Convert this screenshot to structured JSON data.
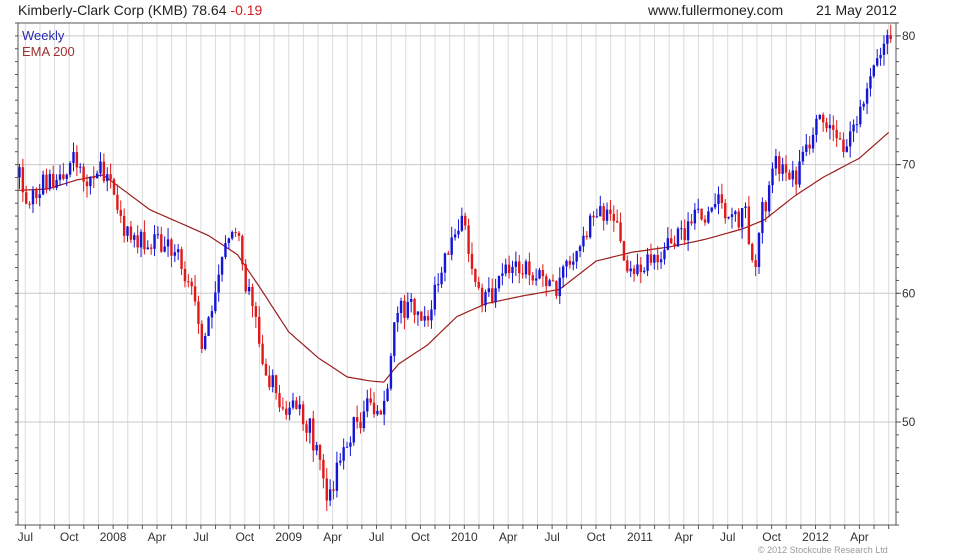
{
  "header": {
    "name": "Kimberly-Clark Corp (KMB)",
    "price": "78.64",
    "change": "-0.19",
    "site": "www.fullermoney.com",
    "date": "21 May 2012"
  },
  "footer": {
    "copyright": "© 2012 Stockcube Research Ltd"
  },
  "colors": {
    "up": "#1515d8",
    "down": "#e01818",
    "ema": "#9a1e1e",
    "grid": "#dcdcdc",
    "axis": "#555555"
  },
  "chart_data": {
    "type": "candlestick",
    "legend": [
      "Weekly",
      "EMA 200"
    ],
    "legend_position": "top-left",
    "ylim": [
      42,
      81
    ],
    "yticks": [
      50,
      60,
      70,
      80
    ],
    "y_axis_side": "right",
    "grid": true,
    "x_range_months": [
      0,
      59.5
    ],
    "xticks": [
      {
        "label": "Jul",
        "month": 0
      },
      {
        "label": "Oct",
        "month": 3
      },
      {
        "label": "2008",
        "month": 6
      },
      {
        "label": "Apr",
        "month": 9
      },
      {
        "label": "Jul",
        "month": 12
      },
      {
        "label": "Oct",
        "month": 15
      },
      {
        "label": "2009",
        "month": 18
      },
      {
        "label": "Apr",
        "month": 21
      },
      {
        "label": "Jul",
        "month": 24
      },
      {
        "label": "Oct",
        "month": 27
      },
      {
        "label": "2010",
        "month": 30
      },
      {
        "label": "Apr",
        "month": 33
      },
      {
        "label": "Jul",
        "month": 36
      },
      {
        "label": "Oct",
        "month": 39
      },
      {
        "label": "2011",
        "month": 42
      },
      {
        "label": "Apr",
        "month": 45
      },
      {
        "label": "Jul",
        "month": 48
      },
      {
        "label": "Oct",
        "month": 51
      },
      {
        "label": "2012",
        "month": 54
      },
      {
        "label": "Apr",
        "month": 57
      }
    ],
    "price_keypoints": [
      [
        -0.5,
        69
      ],
      [
        0.3,
        67.5
      ],
      [
        1.5,
        68.5
      ],
      [
        2.3,
        69
      ],
      [
        3.3,
        70.2
      ],
      [
        4.5,
        69
      ],
      [
        5.3,
        69.7
      ],
      [
        5.8,
        68.5
      ],
      [
        6.6,
        65.5
      ],
      [
        7.5,
        64
      ],
      [
        8.5,
        64.5
      ],
      [
        9.5,
        63.8
      ],
      [
        10.5,
        63.2
      ],
      [
        11.5,
        60
      ],
      [
        12.1,
        55
      ],
      [
        12.5,
        58
      ],
      [
        13,
        61
      ],
      [
        13.5,
        63
      ],
      [
        14.3,
        66
      ],
      [
        14.8,
        62
      ],
      [
        15.5,
        58.5
      ],
      [
        16.1,
        56
      ],
      [
        16.7,
        53
      ],
      [
        17.3,
        52
      ],
      [
        18.3,
        51
      ],
      [
        19.3,
        50
      ],
      [
        20.1,
        46.5
      ],
      [
        20.7,
        44
      ],
      [
        21.3,
        46
      ],
      [
        22.2,
        49
      ],
      [
        23.2,
        51
      ],
      [
        24.3,
        51.5
      ],
      [
        24.8,
        53
      ],
      [
        25.3,
        58
      ],
      [
        26.3,
        59.5
      ],
      [
        27.2,
        58
      ],
      [
        28.2,
        60.5
      ],
      [
        28.8,
        63.5
      ],
      [
        29.5,
        66
      ],
      [
        30.3,
        64
      ],
      [
        30.8,
        61
      ],
      [
        31.3,
        59.5
      ],
      [
        32.3,
        60.5
      ],
      [
        33.3,
        62.5
      ],
      [
        34.3,
        61.5
      ],
      [
        35.3,
        61
      ],
      [
        36.5,
        60.5
      ],
      [
        37.3,
        62.5
      ],
      [
        38.3,
        64.5
      ],
      [
        39.3,
        66.3
      ],
      [
        40.3,
        65.5
      ],
      [
        41.2,
        62.5
      ],
      [
        41.6,
        61.5
      ],
      [
        42.5,
        62
      ],
      [
        43.3,
        63
      ],
      [
        44.3,
        64.5
      ],
      [
        45.3,
        65.3
      ],
      [
        46.3,
        66
      ],
      [
        47.3,
        67.5
      ],
      [
        48.2,
        66
      ],
      [
        49.2,
        66.2
      ],
      [
        49.5,
        63
      ],
      [
        49.8,
        62
      ],
      [
        50.3,
        66
      ],
      [
        51.3,
        70.5
      ],
      [
        52.3,
        69.5
      ],
      [
        52.8,
        68.8
      ],
      [
        53.3,
        71.5
      ],
      [
        54.5,
        73.5
      ],
      [
        55.3,
        71.5
      ],
      [
        56.3,
        72
      ],
      [
        57.3,
        74
      ],
      [
        58,
        77.5
      ],
      [
        58.8,
        79.5
      ],
      [
        59.3,
        78.6
      ]
    ],
    "ema200_keypoints": [
      [
        -0.5,
        68
      ],
      [
        1.5,
        68.1
      ],
      [
        3.5,
        68.8
      ],
      [
        5.3,
        69.2
      ],
      [
        6.5,
        68.2
      ],
      [
        8.5,
        66.5
      ],
      [
        10.5,
        65.5
      ],
      [
        12.5,
        64.5
      ],
      [
        14.5,
        63
      ],
      [
        16,
        60.5
      ],
      [
        18,
        57
      ],
      [
        20,
        55
      ],
      [
        22,
        53.5
      ],
      [
        23.5,
        53.2
      ],
      [
        24.5,
        53.1
      ],
      [
        25.5,
        54.5
      ],
      [
        27.5,
        56
      ],
      [
        29.5,
        58.2
      ],
      [
        31.5,
        59.2
      ],
      [
        34,
        59.8
      ],
      [
        36.5,
        60.3
      ],
      [
        39,
        62.5
      ],
      [
        41.5,
        63.2
      ],
      [
        44,
        63.6
      ],
      [
        46.5,
        64.2
      ],
      [
        49,
        65
      ],
      [
        50.5,
        65.7
      ],
      [
        52.5,
        67.5
      ],
      [
        54.5,
        69
      ],
      [
        57,
        70.5
      ],
      [
        59,
        72.5
      ]
    ]
  }
}
